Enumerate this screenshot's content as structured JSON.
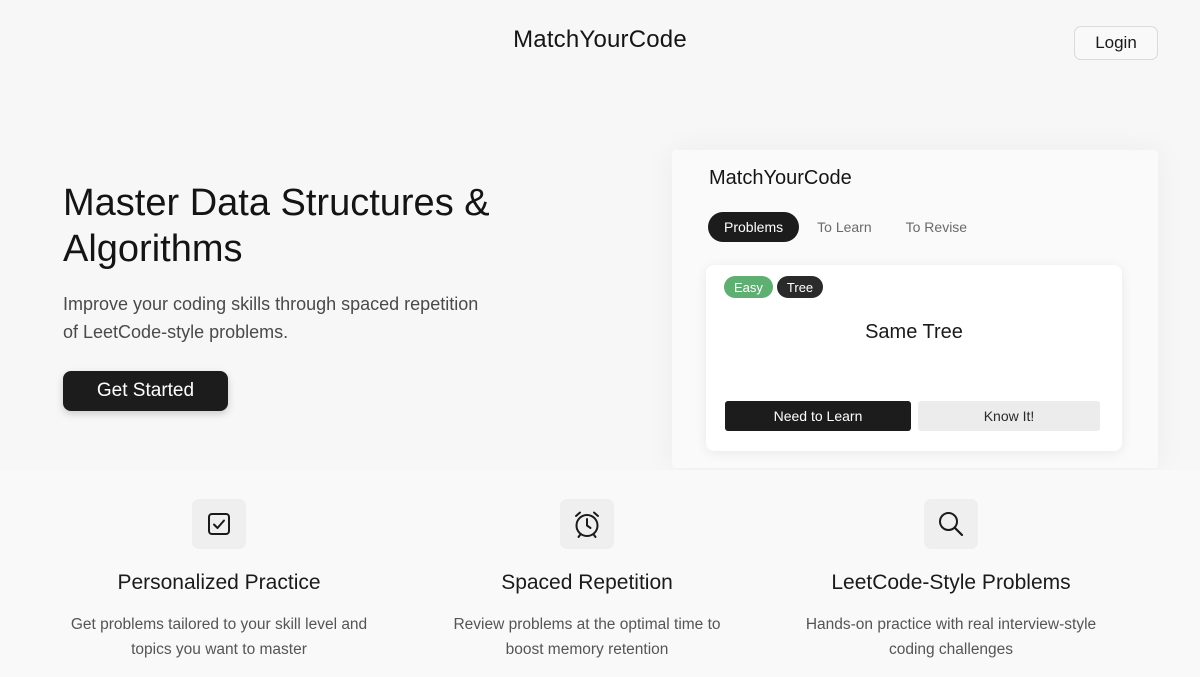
{
  "header": {
    "brand": "MatchYourCode",
    "login_label": "Login"
  },
  "hero": {
    "title": "Master Data Structures & Algorithms",
    "subtitle": "Improve your coding skills through spaced repetition of LeetCode-style problems.",
    "cta_label": "Get Started"
  },
  "preview": {
    "brand": "MatchYourCode",
    "tabs": [
      {
        "label": "Problems",
        "active": true
      },
      {
        "label": "To Learn",
        "active": false
      },
      {
        "label": "To Revise",
        "active": false
      }
    ],
    "card": {
      "difficulty": "Easy",
      "topic": "Tree",
      "title": "Same Tree",
      "primary_action": "Need to Learn",
      "secondary_action": "Know It!"
    }
  },
  "features": [
    {
      "icon": "checkbox-icon",
      "title": "Personalized Practice",
      "description": "Get problems tailored to your skill level and topics you want to master"
    },
    {
      "icon": "alarm-clock-icon",
      "title": "Spaced Repetition",
      "description": "Review problems at the optimal time to boost memory retention"
    },
    {
      "icon": "search-icon",
      "title": "LeetCode-Style Problems",
      "description": "Hands-on practice with real interview-style coding challenges"
    }
  ],
  "colors": {
    "primary": "#1c1c1c",
    "easy_badge": "#5fae72",
    "background": "#f7f7f8"
  }
}
